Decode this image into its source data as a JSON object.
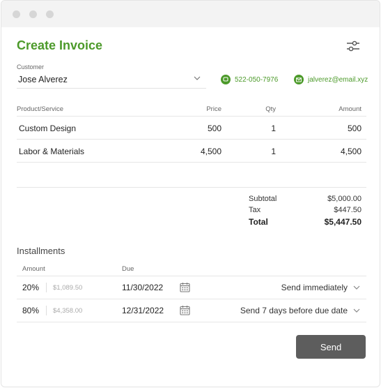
{
  "app": {
    "title": "Create Invoice"
  },
  "customer": {
    "label": "Customer",
    "value": "Jose Alverez",
    "phone": "522-050-7976",
    "email": "jalverez@email.xyz"
  },
  "items": {
    "headers": [
      "Product/Service",
      "Price",
      "Qty",
      "Amount"
    ],
    "rows": [
      {
        "name": "Custom Design",
        "price": "500",
        "qty": "1",
        "amount": "500"
      },
      {
        "name": "Labor & Materials",
        "price": "4,500",
        "qty": "1",
        "amount": "4,500"
      }
    ]
  },
  "summary": {
    "subtotal_label": "Subtotal",
    "subtotal": "$5,000.00",
    "tax_label": "Tax",
    "tax": "$447.50",
    "total_label": "Total",
    "total": "$5,447.50"
  },
  "installments": {
    "title": "Installments",
    "amount_header": "Amount",
    "due_header": "Due",
    "rows": [
      {
        "percent": "20%",
        "amount": "$1,089.50",
        "due": "11/30/2022",
        "send": "Send immediately"
      },
      {
        "percent": "80%",
        "amount": "$4,358.00",
        "due": "12/31/2022",
        "send": "Send 7 days before due date"
      }
    ]
  },
  "actions": {
    "send_label": "Send"
  },
  "colors": {
    "accent": "#4c9a2a",
    "button": "#5d5d5d"
  },
  "icons": {
    "settings": "sliders-icon",
    "chevron": "chevron-down-icon",
    "phone": "phone-chat-icon",
    "email": "envelope-icon",
    "calendar": "calendar-icon"
  }
}
